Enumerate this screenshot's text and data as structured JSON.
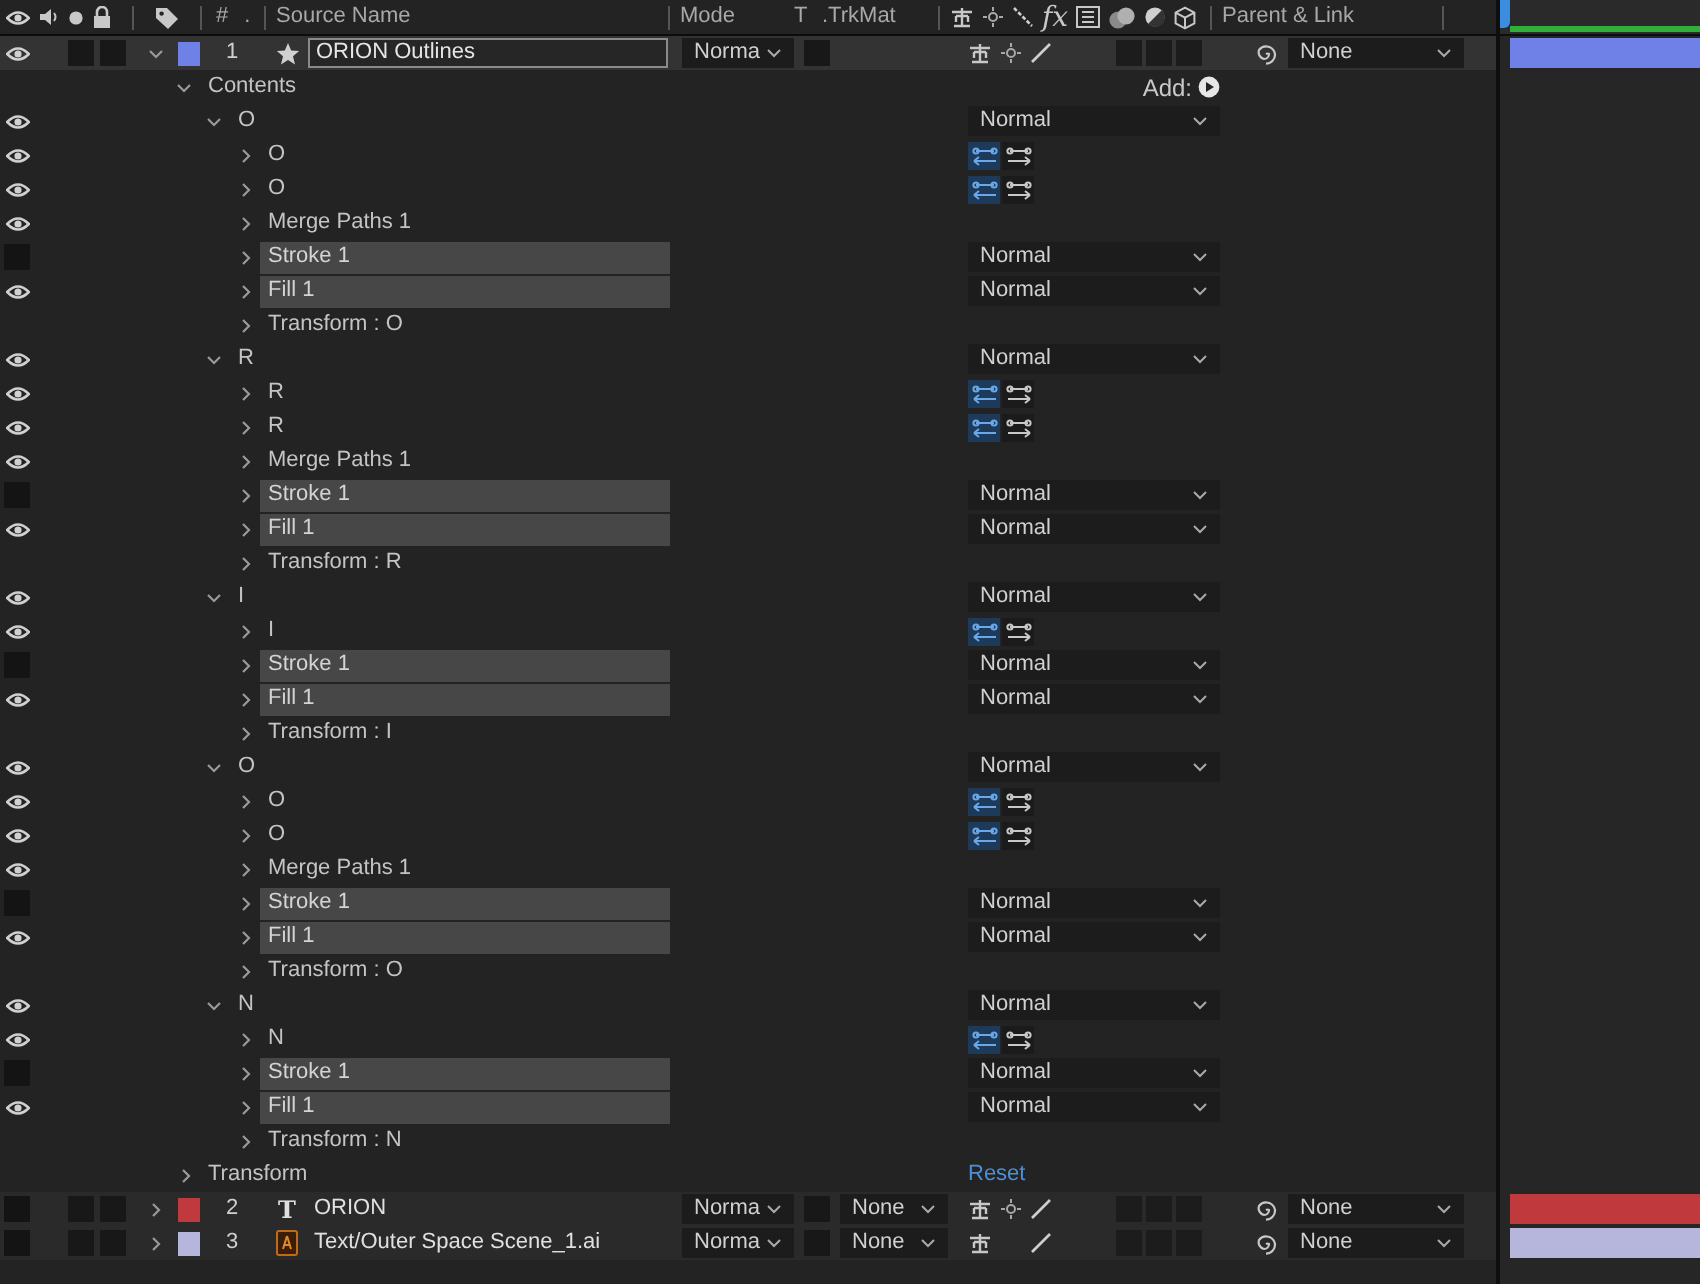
{
  "header": {
    "number": "#",
    "dot": ".",
    "source_name": "Source Name",
    "mode": "Mode",
    "t": "T",
    "trkmat": ".TrkMat",
    "fx": "fx",
    "parent": "Parent & Link"
  },
  "layers": [
    {
      "number": "1",
      "name": "ORION Outlines",
      "kind": "shape",
      "color": "#6f80e6",
      "selected": true,
      "visible": true,
      "expanded": true,
      "mode": "Norma",
      "parent": "None",
      "collapse_switch": true,
      "properties": [
        {
          "name": "Contents",
          "kind": "contents",
          "expanded": true,
          "action": "Add:",
          "children": [
            {
              "name": "O",
              "kind": "group",
              "expanded": true,
              "visible": true,
              "mode": "Normal",
              "children": [
                {
                  "name": "O",
                  "kind": "path",
                  "visible": true,
                  "expanded": false,
                  "reversed": true
                },
                {
                  "name": "O",
                  "kind": "path",
                  "visible": true,
                  "expanded": false,
                  "reversed": true
                },
                {
                  "name": "Merge Paths 1",
                  "kind": "merge",
                  "visible": true,
                  "expanded": false
                },
                {
                  "name": "Stroke 1",
                  "kind": "stroke",
                  "visible": false,
                  "expanded": false,
                  "mode": "Normal"
                },
                {
                  "name": "Fill 1",
                  "kind": "fill",
                  "visible": true,
                  "expanded": false,
                  "mode": "Normal"
                },
                {
                  "name": "Transform : O",
                  "kind": "transform",
                  "expanded": false
                }
              ]
            },
            {
              "name": "R",
              "kind": "group",
              "expanded": true,
              "visible": true,
              "mode": "Normal",
              "children": [
                {
                  "name": "R",
                  "kind": "path",
                  "visible": true,
                  "expanded": false,
                  "reversed": true
                },
                {
                  "name": "R",
                  "kind": "path",
                  "visible": true,
                  "expanded": false,
                  "reversed": true
                },
                {
                  "name": "Merge Paths 1",
                  "kind": "merge",
                  "visible": true,
                  "expanded": false
                },
                {
                  "name": "Stroke 1",
                  "kind": "stroke",
                  "visible": false,
                  "expanded": false,
                  "mode": "Normal"
                },
                {
                  "name": "Fill 1",
                  "kind": "fill",
                  "visible": true,
                  "expanded": false,
                  "mode": "Normal"
                },
                {
                  "name": "Transform : R",
                  "kind": "transform",
                  "expanded": false
                }
              ]
            },
            {
              "name": "I",
              "kind": "group",
              "expanded": true,
              "visible": true,
              "mode": "Normal",
              "children": [
                {
                  "name": "I",
                  "kind": "path",
                  "visible": true,
                  "expanded": false,
                  "reversed": true
                },
                {
                  "name": "Stroke 1",
                  "kind": "stroke",
                  "visible": false,
                  "expanded": false,
                  "mode": "Normal"
                },
                {
                  "name": "Fill 1",
                  "kind": "fill",
                  "visible": true,
                  "expanded": false,
                  "mode": "Normal"
                },
                {
                  "name": "Transform : I",
                  "kind": "transform",
                  "expanded": false
                }
              ]
            },
            {
              "name": "O",
              "kind": "group",
              "expanded": true,
              "visible": true,
              "mode": "Normal",
              "children": [
                {
                  "name": "O",
                  "kind": "path",
                  "visible": true,
                  "expanded": false,
                  "reversed": true
                },
                {
                  "name": "O",
                  "kind": "path",
                  "visible": true,
                  "expanded": false,
                  "reversed": true
                },
                {
                  "name": "Merge Paths 1",
                  "kind": "merge",
                  "visible": true,
                  "expanded": false
                },
                {
                  "name": "Stroke 1",
                  "kind": "stroke",
                  "visible": false,
                  "expanded": false,
                  "mode": "Normal"
                },
                {
                  "name": "Fill 1",
                  "kind": "fill",
                  "visible": true,
                  "expanded": false,
                  "mode": "Normal"
                },
                {
                  "name": "Transform : O",
                  "kind": "transform",
                  "expanded": false
                }
              ]
            },
            {
              "name": "N",
              "kind": "group",
              "expanded": true,
              "visible": true,
              "mode": "Normal",
              "children": [
                {
                  "name": "N",
                  "kind": "path",
                  "visible": true,
                  "expanded": false,
                  "reversed": true
                },
                {
                  "name": "Stroke 1",
                  "kind": "stroke",
                  "visible": false,
                  "expanded": false,
                  "mode": "Normal"
                },
                {
                  "name": "Fill 1",
                  "kind": "fill",
                  "visible": true,
                  "expanded": false,
                  "mode": "Normal"
                },
                {
                  "name": "Transform : N",
                  "kind": "transform",
                  "expanded": false
                }
              ]
            }
          ]
        },
        {
          "name": "Transform",
          "kind": "transform",
          "expanded": false,
          "action": "Reset"
        }
      ]
    },
    {
      "number": "2",
      "name": "ORION",
      "kind": "text",
      "icon": "T",
      "color": "#c0393d",
      "selected": false,
      "visible": false,
      "expanded": false,
      "mode": "Norma",
      "trkmat": "None",
      "parent": "None",
      "collapse_switch": true
    },
    {
      "number": "3",
      "name": "Text/Outer Space Scene_1.ai",
      "kind": "footage",
      "color": "#b6b6dc",
      "selected": false,
      "visible": false,
      "expanded": false,
      "mode": "Norma",
      "trkmat": "None",
      "parent": "None",
      "collapse_switch": false
    }
  ]
}
